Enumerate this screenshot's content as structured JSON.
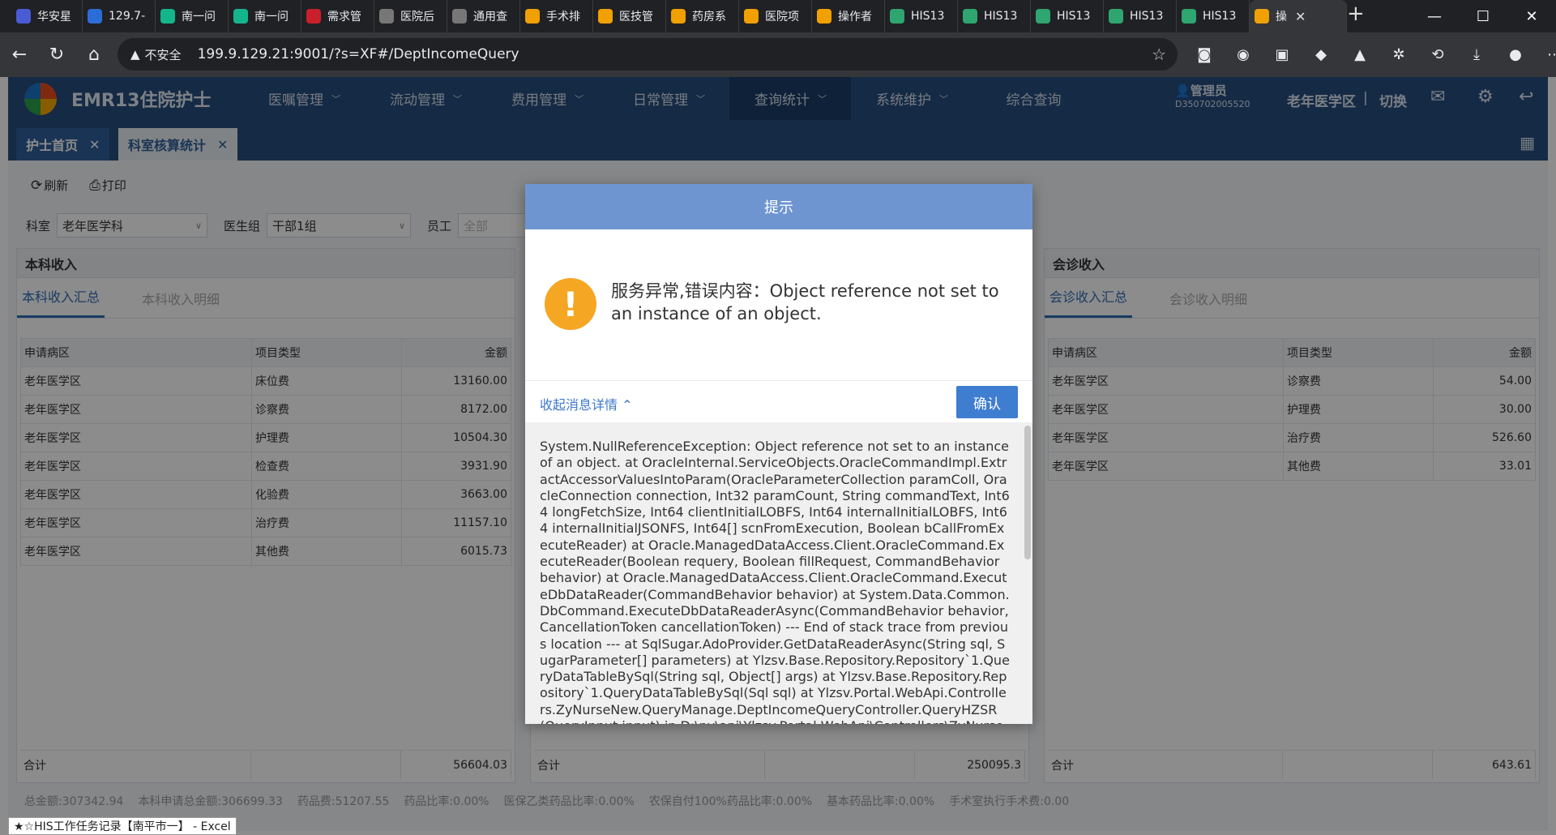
{
  "browser": {
    "tabs": [
      {
        "label": "华安星",
        "color": "#4a5bd6"
      },
      {
        "label": "129.7-",
        "color": "#2b6dd6"
      },
      {
        "label": "南一问",
        "color": "#15b58b"
      },
      {
        "label": "南一问",
        "color": "#15b58b"
      },
      {
        "label": "需求管",
        "color": "#c9202c"
      },
      {
        "label": "医院后",
        "color": "#777777"
      },
      {
        "label": "通用查",
        "color": "#777777"
      },
      {
        "label": "手术排",
        "color": "#f0a000"
      },
      {
        "label": "医技管",
        "color": "#f0a000"
      },
      {
        "label": "药房系",
        "color": "#f0a000"
      },
      {
        "label": "医院项",
        "color": "#f0a000"
      },
      {
        "label": "操作者",
        "color": "#f0a000"
      },
      {
        "label": "HIS13",
        "color": "#2fa56f"
      },
      {
        "label": "HIS13",
        "color": "#2fa56f"
      },
      {
        "label": "HIS13",
        "color": "#2fa56f"
      },
      {
        "label": "HIS13",
        "color": "#2fa56f"
      },
      {
        "label": "HIS13",
        "color": "#2fa56f"
      },
      {
        "label": "操",
        "color": "#f0a000"
      }
    ],
    "insecure_label": "不安全",
    "url": "199.9.129.21:9001/?s=XF#/DeptIncomeQuery"
  },
  "app": {
    "title": "EMR13住院护士",
    "menus": [
      "医嘱管理",
      "流动管理",
      "费用管理",
      "日常管理",
      "查询统计",
      "系统维护",
      "综合查询"
    ],
    "user_name": "管理员",
    "user_id": "D350702005520",
    "ward": "老年医学区",
    "switch_label": "切换",
    "page_tabs": [
      "护士首页",
      "科室核算统计"
    ]
  },
  "toolbar": {
    "refresh": "刷新",
    "print": "打印"
  },
  "filters": {
    "dept_label": "科室",
    "dept_value": "老年医学科",
    "group_label": "医生组",
    "group_value": "干部1组",
    "staff_label": "员工",
    "staff_placeholder": "全部"
  },
  "left_panel": {
    "title": "本科收入",
    "tabs": [
      "本科收入汇总",
      "本科收入明细"
    ],
    "columns": [
      "申请病区",
      "项目类型",
      "金额"
    ],
    "rows": [
      [
        "老年医学区",
        "床位费",
        "13160.00"
      ],
      [
        "老年医学区",
        "诊察费",
        "8172.00"
      ],
      [
        "老年医学区",
        "护理费",
        "10504.30"
      ],
      [
        "老年医学区",
        "检查费",
        "3931.90"
      ],
      [
        "老年医学区",
        "化验费",
        "3663.00"
      ],
      [
        "老年医学区",
        "治疗费",
        "11157.10"
      ],
      [
        "老年医学区",
        "其他费",
        "6015.73"
      ]
    ],
    "total_label": "合计",
    "total_value": "56604.03"
  },
  "middle_panel": {
    "total_label": "合计",
    "total_value": "250095.3"
  },
  "right_panel": {
    "title": "会诊收入",
    "tabs": [
      "会诊收入汇总",
      "会诊收入明细"
    ],
    "columns": [
      "申请病区",
      "项目类型",
      "金额"
    ],
    "rows": [
      [
        "老年医学区",
        "诊察费",
        "54.00"
      ],
      [
        "老年医学区",
        "护理费",
        "30.00"
      ],
      [
        "老年医学区",
        "治疗费",
        "526.60"
      ],
      [
        "老年医学区",
        "其他费",
        "33.01"
      ]
    ],
    "total_label": "合计",
    "total_value": "643.61"
  },
  "stats": {
    "s1": "总金额:307342.94",
    "s2": "本科申请总金额:306699.33",
    "s3": "药品费:51207.55",
    "s4": "药品比率:0.00%",
    "s5": "医保乙类药品比率:0.00%",
    "s6": "农保自付100%药品比率:0.00%",
    "s7": "基本药品比率:0.00%",
    "s8": "手术室执行手术费:0.00"
  },
  "dialog": {
    "title": "提示",
    "message": "服务异常,错误内容：Object reference not set to an instance of an object.",
    "collapse_label": "收起消息详情",
    "confirm_label": "确认",
    "detail": "System.NullReferenceException: Object reference not set to an instance of an object. at OracleInternal.ServiceObjects.OracleCommandImpl.ExtractAccessorValuesIntoParam(OracleParameterCollection paramColl, OracleConnection connection, Int32 paramCount, String commandText, Int64 longFetchSize, Int64 clientInitialLOBFS, Int64 internalInitialLOBFS, Int64 internalInitialJSONFS, Int64[] scnFromExecution, Boolean bCallFromExecuteReader) at Oracle.ManagedDataAccess.Client.OracleCommand.ExecuteReader(Boolean requery, Boolean fillRequest, CommandBehavior behavior) at Oracle.ManagedDataAccess.Client.OracleCommand.ExecuteDbDataReader(CommandBehavior behavior) at System.Data.Common.DbCommand.ExecuteDbDataReaderAsync(CommandBehavior behavior, CancellationToken cancellationToken) --- End of stack trace from previous location --- at SqlSugar.AdoProvider.GetDataReaderAsync(String sql, SugarParameter[] parameters) at Ylzsv.Base.Repository.Repository`1.QueryDataTableBySql(String sql, Object[] args) at Ylzsv.Base.Repository.Repository`1.QueryDataTableBySql(Sql sql) at Ylzsv.Portal.WebApi.Controllers.ZyNurseNew.QueryManage.DeptIncomeQueryController.QueryHZSR(QueryInput input) in D:\\ny\\api\\Ylzsv.Portal.WebApi\\Controllers\\ZyNurseNew\\QueryManage\\DeptIncomeQueryController.cs:line"
  },
  "taskbar": {
    "label": "★☆HIS工作任务记录【南平市一】 - Excel"
  }
}
